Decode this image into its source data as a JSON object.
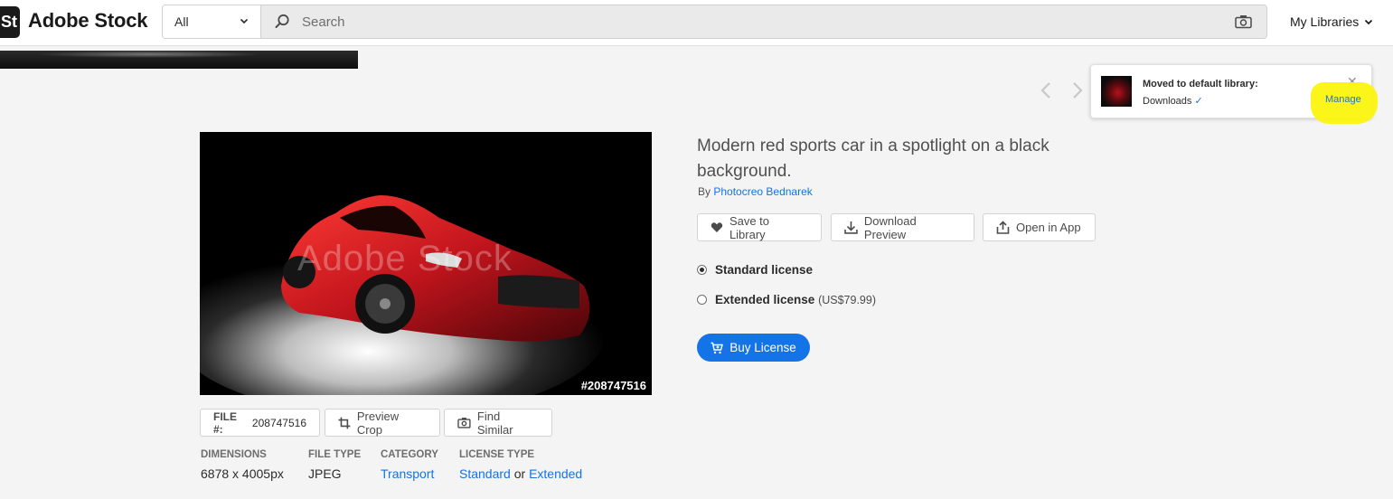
{
  "header": {
    "logo_mark": "St",
    "logo_text": "Adobe Stock",
    "scope": "All",
    "search_placeholder": "Search",
    "libraries_label": "My Libraries"
  },
  "toast": {
    "title": "Moved to default library:",
    "library": "Downloads",
    "check": "✓",
    "close": "✕",
    "manage": "Manage"
  },
  "asset": {
    "id_overlay": "#208747516",
    "watermark": "Adobe Stock",
    "title": "Modern red sports car in a spotlight on a black background.",
    "by_prefix": "By",
    "author": "Photocreo Bednarek"
  },
  "actions": {
    "save": "Save to Library",
    "download": "Download Preview",
    "open": "Open in App"
  },
  "licenses": [
    {
      "name": "Standard license",
      "price": "",
      "selected": true
    },
    {
      "name": "Extended license",
      "price": "(US$79.99)",
      "selected": false
    }
  ],
  "buy_label": "Buy License",
  "file_bar": {
    "file_label": "FILE #:",
    "file_value": "208747516",
    "preview_crop": "Preview Crop",
    "find_similar": "Find Similar"
  },
  "meta": {
    "dimensions_label": "DIMENSIONS",
    "dimensions_value": "6878 x 4005px",
    "filetype_label": "FILE TYPE",
    "filetype_value": "JPEG",
    "category_label": "CATEGORY",
    "category_value": "Transport",
    "license_label": "LICENSE TYPE",
    "license_standard": "Standard",
    "license_or": "or",
    "license_extended": "Extended"
  },
  "colors": {
    "accent": "#1473e6",
    "highlight": "#fbf40d",
    "car_red": "#c0141c"
  }
}
